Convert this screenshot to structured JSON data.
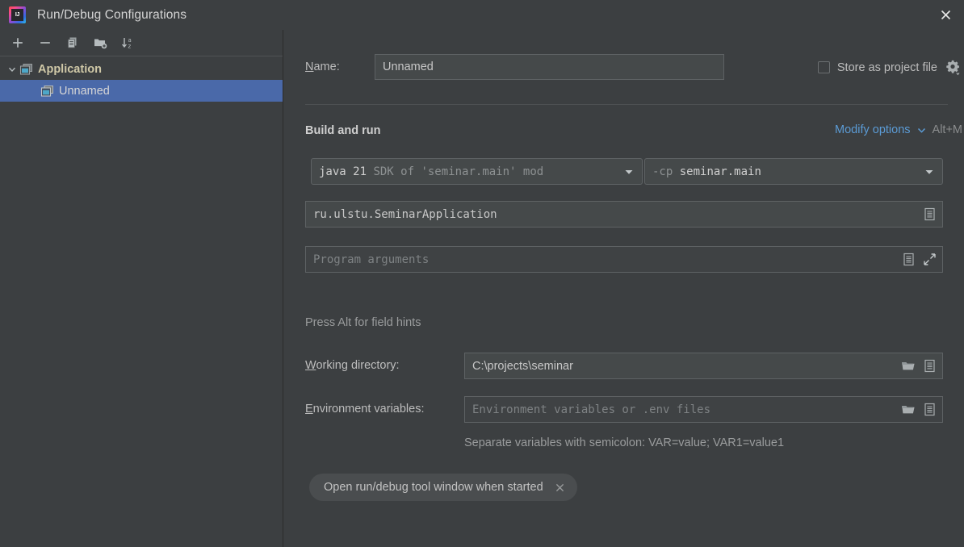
{
  "window": {
    "title": "Run/Debug Configurations",
    "logo_text": "IJ",
    "close_icon": "close-icon"
  },
  "left_panel": {
    "toolbar": [
      {
        "name": "add-configuration-button",
        "icon": "plus-icon",
        "tooltip": "Add New Configuration"
      },
      {
        "name": "remove-configuration-button",
        "icon": "minus-icon",
        "tooltip": "Remove Configuration"
      },
      {
        "name": "copy-configuration-button",
        "icon": "copy-icon",
        "tooltip": "Copy Configuration"
      },
      {
        "name": "new-folder-button",
        "icon": "new-folder-icon",
        "tooltip": "Create New Folder"
      },
      {
        "name": "sort-configurations-button",
        "icon": "sort-az-icon",
        "tooltip": "Sort Configurations"
      }
    ],
    "tree": [
      {
        "label": "Application",
        "type": "group",
        "expanded": true,
        "icon": "application-icon",
        "selected": false
      },
      {
        "label": "Unnamed",
        "type": "child",
        "icon": "application-icon",
        "selected": true
      }
    ]
  },
  "form": {
    "name_label": "Name:",
    "name_mnemonic": "N",
    "name_label_rest": "ame:",
    "name_value": "Unnamed",
    "store_as_project_file_label": "Store as project file",
    "store_as_project_file_checked": false,
    "store_gear_icon": "gear-dropdown-icon",
    "section_title": "Build and run",
    "modify_options_label": "Modify options",
    "modify_options_shortcut": "Alt+M",
    "modify_options_icon": "chevron-down-icon",
    "sdk_combo": {
      "primary": "java 21",
      "secondary": "SDK of 'seminar.main' mod",
      "caret_icon": "caret-down-icon"
    },
    "classpath_combo": {
      "prefix": "-cp",
      "value": "seminar.main",
      "caret_icon": "caret-down-icon"
    },
    "main_class_value": "ru.ulstu.SeminarApplication",
    "main_class_icon": "browse-list-icon",
    "program_arguments_placeholder": "Program arguments",
    "program_arguments_value": "",
    "program_arguments_icons": [
      "browse-list-icon",
      "expand-icon"
    ],
    "alt_hint": "Press Alt for field hints",
    "working_directory_label": "Working directory:",
    "working_directory_mnemonic": "W",
    "working_directory_label_rest": "orking directory:",
    "working_directory_value": "C:\\projects\\seminar",
    "working_directory_icons": [
      "folder-icon",
      "browse-list-icon"
    ],
    "environment_variables_label": "Environment variables:",
    "environment_variables_mnemonic": "E",
    "environment_variables_label_rest": "nvironment variables:",
    "environment_variables_placeholder": "Environment variables or .env files",
    "environment_variables_value": "",
    "environment_variables_icons": [
      "folder-icon",
      "browse-list-icon"
    ],
    "environment_variables_hint": "Separate variables with semicolon: VAR=value; VAR1=value1",
    "chip_label": "Open run/debug tool window when started",
    "chip_close_icon": "close-icon"
  },
  "colors": {
    "background": "#3c3f41",
    "field_background": "#45494a",
    "selection_blue": "#4a69a9",
    "link_blue": "#5b9bd5",
    "text": "#bbbbbb",
    "group_text": "#cfc8a7",
    "icon_cyan": "#4ea7c8"
  }
}
